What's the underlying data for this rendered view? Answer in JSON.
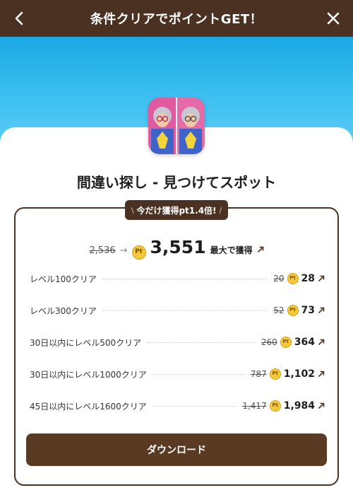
{
  "header": {
    "title": "条件クリアでポイントGET！",
    "back_icon": "chevron-left-icon",
    "close_icon": "close-icon"
  },
  "app": {
    "name": "間違い探し - 見つけてスポット",
    "icon": "app-icon"
  },
  "bonus_badge": {
    "left_mark": "\\",
    "text": "今だけ獲得pt1.4倍!",
    "right_mark": "/"
  },
  "total": {
    "original": "2,536",
    "arrow": "→",
    "coin_label": "Pt",
    "value": "3,551",
    "suffix": "最大で獲得"
  },
  "tasks": [
    {
      "label": "レベル100クリア",
      "original": "20",
      "value": "28"
    },
    {
      "label": "レベル300クリア",
      "original": "52",
      "value": "73"
    },
    {
      "label": "30日以内にレベル500クリア",
      "original": "260",
      "value": "364"
    },
    {
      "label": "30日以内にレベル1000クリア",
      "original": "787",
      "value": "1,102"
    },
    {
      "label": "45日以内にレベル1600クリア",
      "original": "1,417",
      "value": "1,984"
    }
  ],
  "download_button": "ダウンロード",
  "colors": {
    "brand_brown": "#4a3121",
    "button_brown": "#5a3a22",
    "sky_blue": "#3fc1f1",
    "coin_gold": "#f5c93b"
  }
}
